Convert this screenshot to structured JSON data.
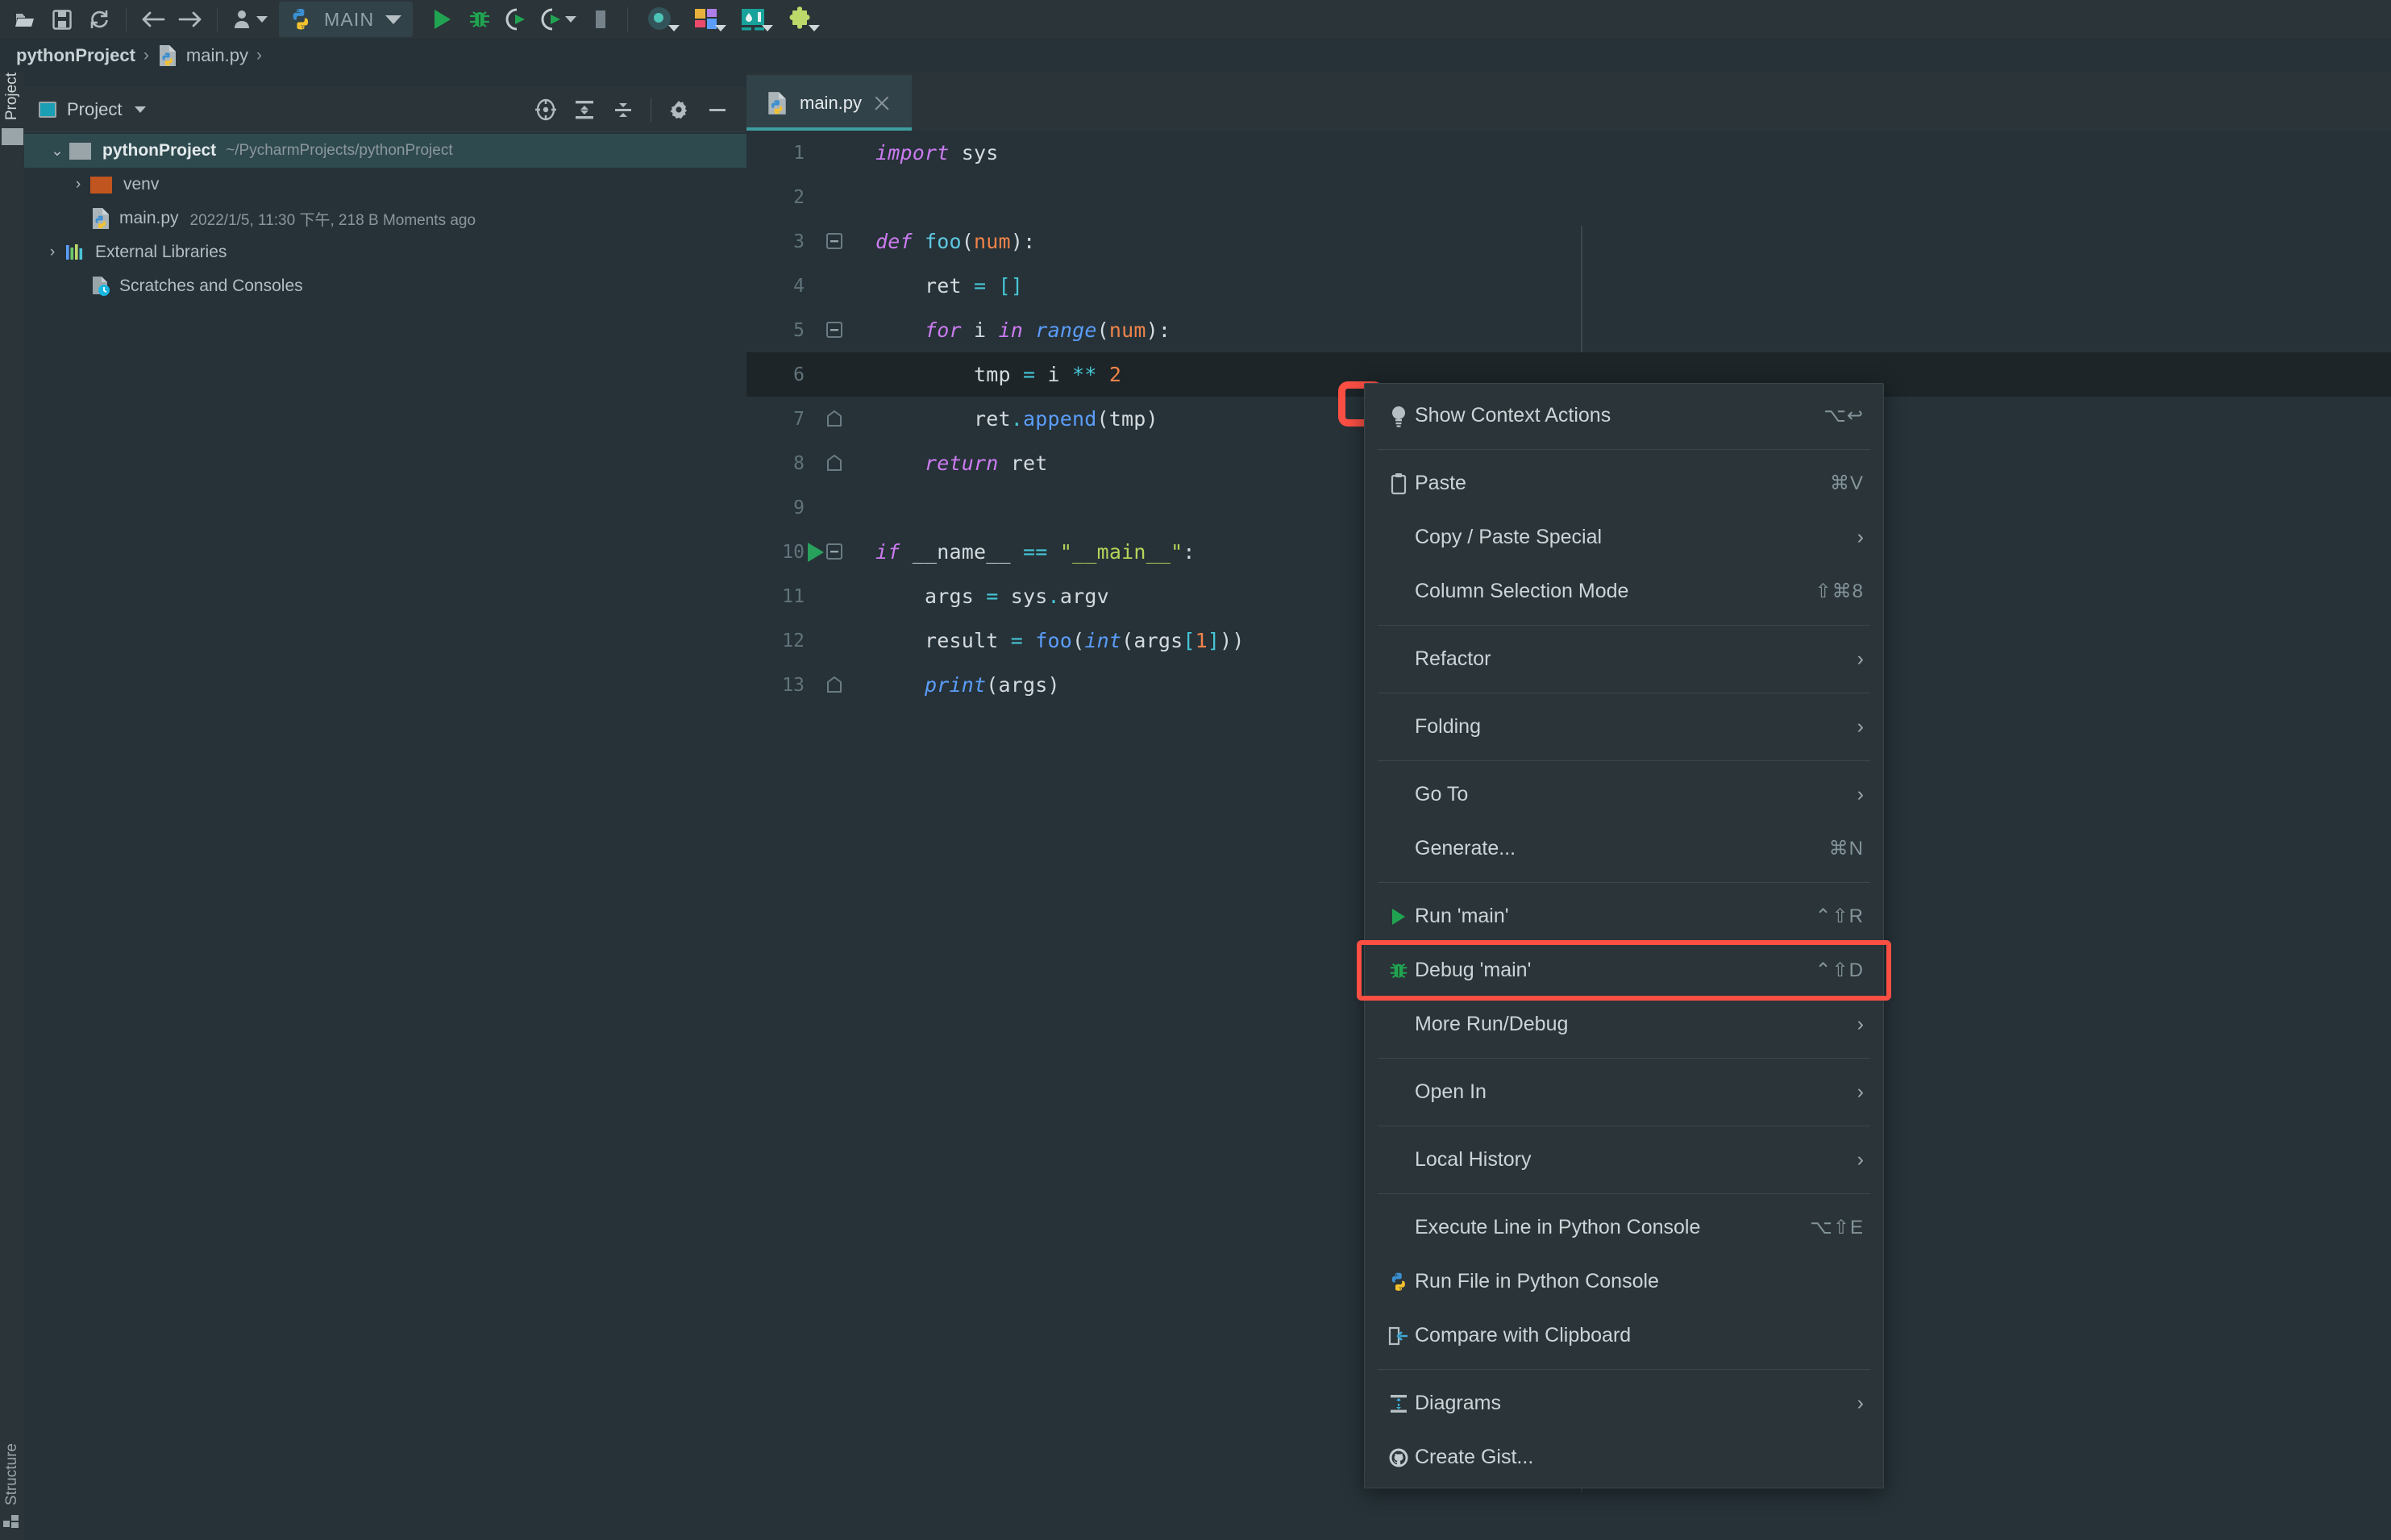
{
  "toolbar": {
    "icons": [
      {
        "name": "open-project-icon",
        "glyph": "open"
      },
      {
        "name": "save-all-icon",
        "glyph": "save"
      },
      {
        "name": "sync-refresh-icon",
        "glyph": "sync"
      },
      {
        "name": "navigate-back-icon",
        "glyph": "back"
      },
      {
        "name": "navigate-forward-icon",
        "glyph": "forward"
      },
      {
        "name": "user-profile-icon",
        "glyph": "user"
      }
    ],
    "run_config": {
      "name": "MAIN",
      "icon": "python-icon"
    },
    "run_label": "Run",
    "debug_label": "Debug",
    "run_coverage_label": "Run with Coverage",
    "profile_label": "Profile",
    "stop_label": "Stop",
    "right_icons": [
      {
        "name": "search-everywhere-icon"
      },
      {
        "name": "layout-switcher-icon"
      },
      {
        "name": "database-icon"
      },
      {
        "name": "plugins-puzzle-icon"
      }
    ]
  },
  "breadcrumb": {
    "project": "pythonProject",
    "file": "main.py",
    "separator": "›"
  },
  "stripes": {
    "project_label": "Project",
    "structure_label": "Structure"
  },
  "project_panel": {
    "title": "Project",
    "tools": [
      {
        "name": "select-opened-file-icon"
      },
      {
        "name": "expand-all-icon"
      },
      {
        "name": "collapse-all-icon"
      },
      {
        "name": "settings-gear-icon"
      },
      {
        "name": "hide-panel-icon"
      }
    ],
    "tree": [
      {
        "label": "pythonProject",
        "path": "~/PycharmProjects/pythonProject",
        "icon": "folder-gray-icon",
        "arrow": "⌄",
        "selected": true,
        "bold": true,
        "indent": 0
      },
      {
        "label": "venv",
        "path": "",
        "icon": "folder-orange-icon",
        "arrow": "›",
        "selected": false,
        "bold": false,
        "indent": 1
      },
      {
        "label": "main.py",
        "meta": "2022/1/5, 11:30 下午, 218 B Moments ago",
        "icon": "python-file-icon",
        "arrow": "",
        "selected": false,
        "bold": false,
        "indent": 1
      },
      {
        "label": "External Libraries",
        "path": "",
        "icon": "libraries-icon",
        "arrow": "›",
        "selected": false,
        "bold": false,
        "indent": 0
      },
      {
        "label": "Scratches and Consoles",
        "path": "",
        "icon": "scratches-icon",
        "arrow": "",
        "selected": false,
        "bold": false,
        "indent": 0
      }
    ]
  },
  "editor": {
    "tab": {
      "label": "main.py",
      "icon": "python-file-icon",
      "close": "close-icon"
    },
    "current_line": 6,
    "lines": [
      {
        "n": 1,
        "tokens": [
          {
            "t": "import ",
            "c": "kw"
          },
          {
            "t": "sys",
            "c": "plain"
          }
        ]
      },
      {
        "n": 2,
        "tokens": []
      },
      {
        "n": 3,
        "fold": "minus",
        "tokens": [
          {
            "t": "def ",
            "c": "kw"
          },
          {
            "t": "foo",
            "c": "def"
          },
          {
            "t": "(",
            "c": "plain"
          },
          {
            "t": "num",
            "c": "par"
          },
          {
            "t": "):",
            "c": "plain"
          }
        ]
      },
      {
        "n": 4,
        "tokens": [
          {
            "t": "    ret ",
            "c": "plain"
          },
          {
            "t": "=",
            "c": "op"
          },
          {
            "t": " ",
            "c": "plain"
          },
          {
            "t": "[]",
            "c": "op"
          }
        ]
      },
      {
        "n": 5,
        "fold": "minus",
        "tokens": [
          {
            "t": "    ",
            "c": "plain"
          },
          {
            "t": "for ",
            "c": "kw"
          },
          {
            "t": "i ",
            "c": "plain"
          },
          {
            "t": "in ",
            "c": "kw"
          },
          {
            "t": "range",
            "c": "fn-i"
          },
          {
            "t": "(",
            "c": "plain"
          },
          {
            "t": "num",
            "c": "par"
          },
          {
            "t": "):",
            "c": "plain"
          }
        ]
      },
      {
        "n": 6,
        "tokens": [
          {
            "t": "        tmp ",
            "c": "plain"
          },
          {
            "t": "=",
            "c": "op"
          },
          {
            "t": " i ",
            "c": "plain"
          },
          {
            "t": "**",
            "c": "op"
          },
          {
            "t": " ",
            "c": "plain"
          },
          {
            "t": "2",
            "c": "num"
          }
        ]
      },
      {
        "n": 7,
        "fold": "end",
        "tokens": [
          {
            "t": "        ret",
            "c": "plain"
          },
          {
            "t": ".",
            "c": "dot"
          },
          {
            "t": "append",
            "c": "fn"
          },
          {
            "t": "(tmp)",
            "c": "plain"
          }
        ]
      },
      {
        "n": 8,
        "fold": "end",
        "tokens": [
          {
            "t": "    ",
            "c": "plain"
          },
          {
            "t": "return ",
            "c": "kw"
          },
          {
            "t": "ret",
            "c": "plain"
          }
        ]
      },
      {
        "n": 9,
        "tokens": []
      },
      {
        "n": 10,
        "fold": "minus",
        "run": true,
        "tokens": [
          {
            "t": "if ",
            "c": "kw"
          },
          {
            "t": "__name__ ",
            "c": "plain"
          },
          {
            "t": "==",
            "c": "op"
          },
          {
            "t": " ",
            "c": "plain"
          },
          {
            "t": "\"__main__\"",
            "c": "str"
          },
          {
            "t": ":",
            "c": "plain"
          }
        ]
      },
      {
        "n": 11,
        "tokens": [
          {
            "t": "    args ",
            "c": "plain"
          },
          {
            "t": "=",
            "c": "op"
          },
          {
            "t": " sys",
            "c": "plain"
          },
          {
            "t": ".",
            "c": "dot"
          },
          {
            "t": "argv",
            "c": "plain"
          }
        ]
      },
      {
        "n": 12,
        "tokens": [
          {
            "t": "    result ",
            "c": "plain"
          },
          {
            "t": "=",
            "c": "op"
          },
          {
            "t": " ",
            "c": "plain"
          },
          {
            "t": "foo",
            "c": "fn"
          },
          {
            "t": "(",
            "c": "plain"
          },
          {
            "t": "int",
            "c": "fn-i"
          },
          {
            "t": "(args",
            "c": "plain"
          },
          {
            "t": "[",
            "c": "op"
          },
          {
            "t": "1",
            "c": "num"
          },
          {
            "t": "]",
            "c": "op"
          },
          {
            "t": "))",
            "c": "plain"
          }
        ]
      },
      {
        "n": 13,
        "fold": "end",
        "tokens": [
          {
            "t": "    ",
            "c": "plain"
          },
          {
            "t": "print",
            "c": "fn-i"
          },
          {
            "t": "(args)",
            "c": "plain"
          }
        ]
      }
    ]
  },
  "context_menu": {
    "items": [
      {
        "label": "Show Context Actions",
        "accel": "⌥↩",
        "icon": "lightbulb-icon",
        "arrow": false,
        "highlight": false
      },
      {
        "sep": true
      },
      {
        "label": "Paste",
        "accel": "⌘V",
        "icon": "clipboard-icon",
        "arrow": false,
        "highlight": false
      },
      {
        "label": "Copy / Paste Special",
        "accel": "",
        "icon": "",
        "arrow": true,
        "highlight": false
      },
      {
        "label": "Column Selection Mode",
        "accel": "⇧⌘8",
        "icon": "",
        "arrow": false,
        "highlight": false
      },
      {
        "sep": true
      },
      {
        "label": "Refactor",
        "accel": "",
        "icon": "",
        "arrow": true,
        "highlight": false
      },
      {
        "sep": true
      },
      {
        "label": "Folding",
        "accel": "",
        "icon": "",
        "arrow": true,
        "highlight": false
      },
      {
        "sep": true
      },
      {
        "label": "Go To",
        "accel": "",
        "icon": "",
        "arrow": true,
        "highlight": false
      },
      {
        "label": "Generate...",
        "accel": "⌘N",
        "icon": "",
        "arrow": false,
        "highlight": false
      },
      {
        "sep": true
      },
      {
        "label": "Run 'main'",
        "accel": "⌃⇧R",
        "icon": "run-play-icon",
        "arrow": false,
        "highlight": false
      },
      {
        "label": "Debug 'main'",
        "accel": "⌃⇧D",
        "icon": "debug-bug-icon",
        "arrow": false,
        "highlight": true
      },
      {
        "label": "More Run/Debug",
        "accel": "",
        "icon": "",
        "arrow": true,
        "highlight": false
      },
      {
        "sep": true
      },
      {
        "label": "Open In",
        "accel": "",
        "icon": "",
        "arrow": true,
        "highlight": false
      },
      {
        "sep": true
      },
      {
        "label": "Local History",
        "accel": "",
        "icon": "",
        "arrow": true,
        "highlight": false
      },
      {
        "sep": true
      },
      {
        "label": "Execute Line in Python Console",
        "accel": "⌥⇧E",
        "icon": "",
        "arrow": false,
        "highlight": false
      },
      {
        "label": "Run File in Python Console",
        "accel": "",
        "icon": "python-icon",
        "arrow": false,
        "highlight": false
      },
      {
        "label": "Compare with Clipboard",
        "accel": "",
        "icon": "compare-icon",
        "arrow": false,
        "highlight": false
      },
      {
        "sep": true
      },
      {
        "label": "Diagrams",
        "accel": "",
        "icon": "diagrams-icon",
        "arrow": true,
        "highlight": false
      },
      {
        "label": "Create Gist...",
        "accel": "",
        "icon": "github-icon",
        "arrow": false,
        "highlight": false
      }
    ]
  },
  "annotations": {
    "highlight_color": "#fb4f44",
    "gutter_box_name": "red-annotation-box"
  }
}
